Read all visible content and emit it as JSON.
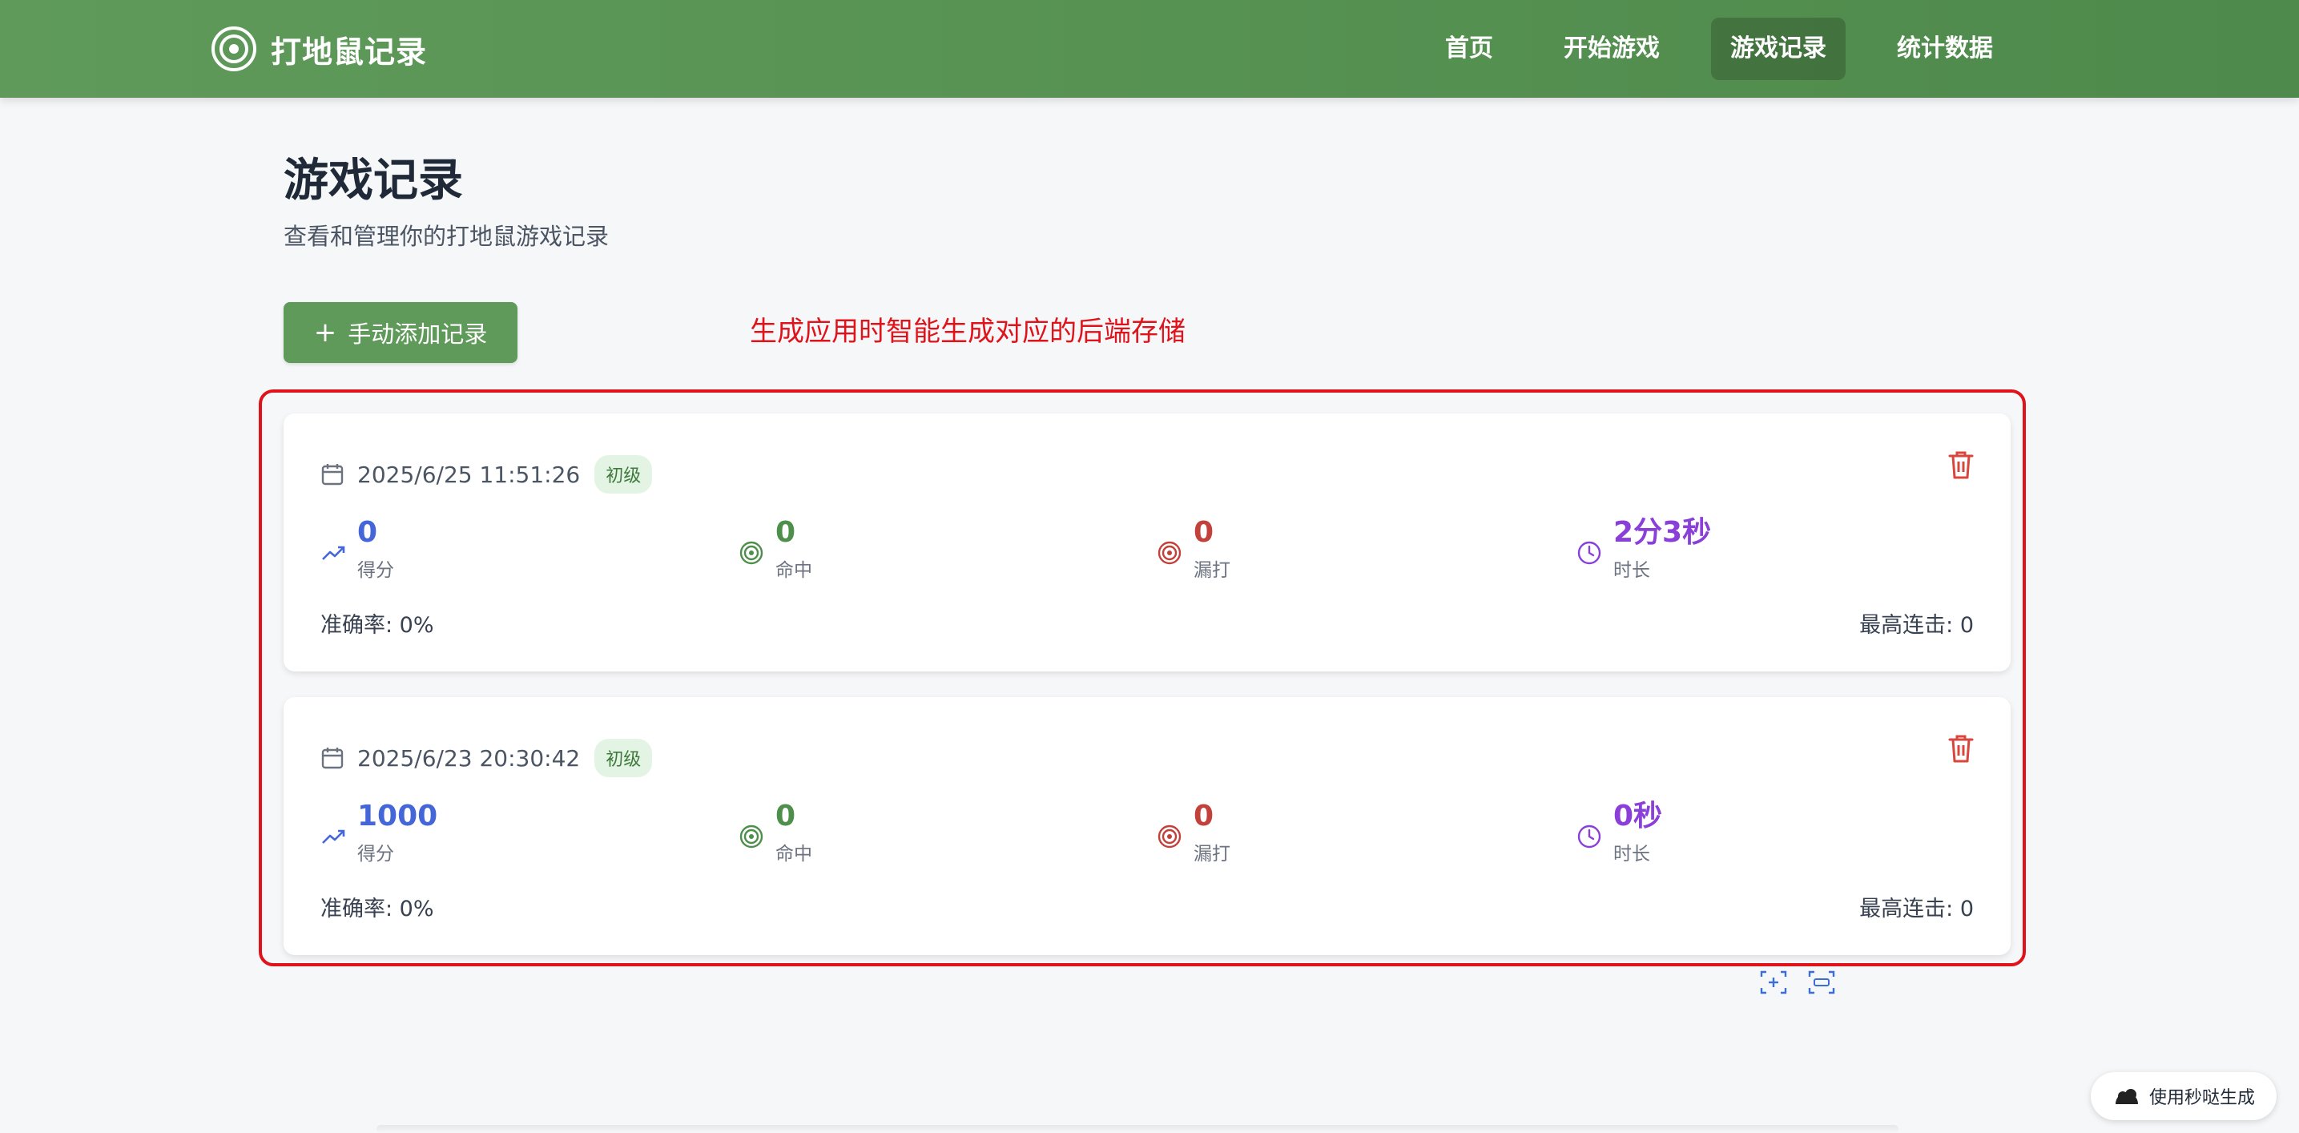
{
  "header": {
    "title": "打地鼠记录",
    "nav": [
      "首页",
      "开始游戏",
      "游戏记录",
      "统计数据"
    ],
    "active_index": 2
  },
  "page": {
    "title": "游戏记录",
    "subtitle": "查看和管理你的打地鼠游戏记录",
    "add_button": "手动添加记录"
  },
  "annotation": {
    "text": "生成应用时智能生成对应的后端存储"
  },
  "records": [
    {
      "date": "2025/6/25 11:51:26",
      "level": "初级",
      "score": "0",
      "score_label": "得分",
      "hits": "0",
      "hits_label": "命中",
      "misses": "0",
      "misses_label": "漏打",
      "duration": "2分3秒",
      "duration_label": "时长",
      "accuracy": "准确率: 0%",
      "max_combo": "最高连击: 0"
    },
    {
      "date": "2025/6/23 20:30:42",
      "level": "初级",
      "score": "1000",
      "score_label": "得分",
      "hits": "0",
      "hits_label": "命中",
      "misses": "0",
      "misses_label": "漏打",
      "duration": "0秒",
      "duration_label": "时长",
      "accuracy": "准确率: 0%",
      "max_combo": "最高连击: 0"
    }
  ],
  "float_button": "使用秒哒生成",
  "colors": {
    "header": "#5f9a5a",
    "score": "#4466d8",
    "hits": "#4e8f4b",
    "misses": "#c2413b",
    "duration": "#8b3fd9",
    "annotation": "#e0131b"
  }
}
